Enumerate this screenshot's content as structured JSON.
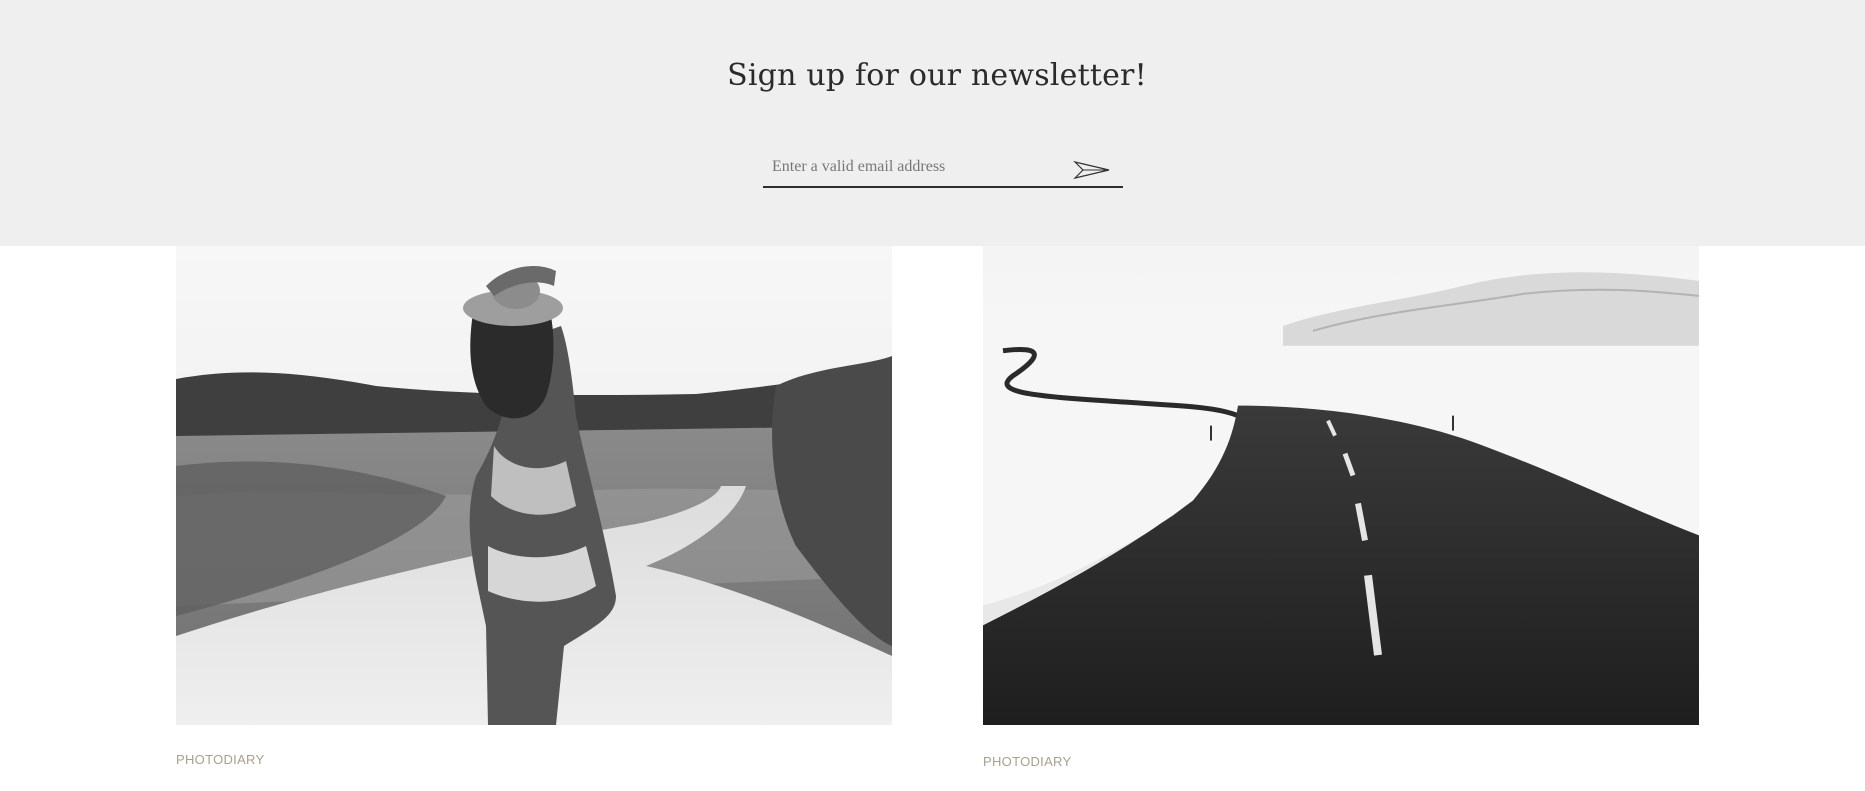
{
  "newsletter": {
    "title": "Sign up for our newsletter!",
    "email_placeholder": "Enter a valid email address",
    "submit_icon": "paper-plane-icon"
  },
  "posts": [
    {
      "category": "PHOTODIARY",
      "image": "woman-in-hat-on-dirt-road-photo"
    },
    {
      "category": "PHOTODIARY",
      "image": "winding-road-through-snow-photo"
    }
  ],
  "colors": {
    "newsletter_bg": "#efefef",
    "text_dark": "#2a2a2a",
    "category_text": "#a99f8e"
  }
}
